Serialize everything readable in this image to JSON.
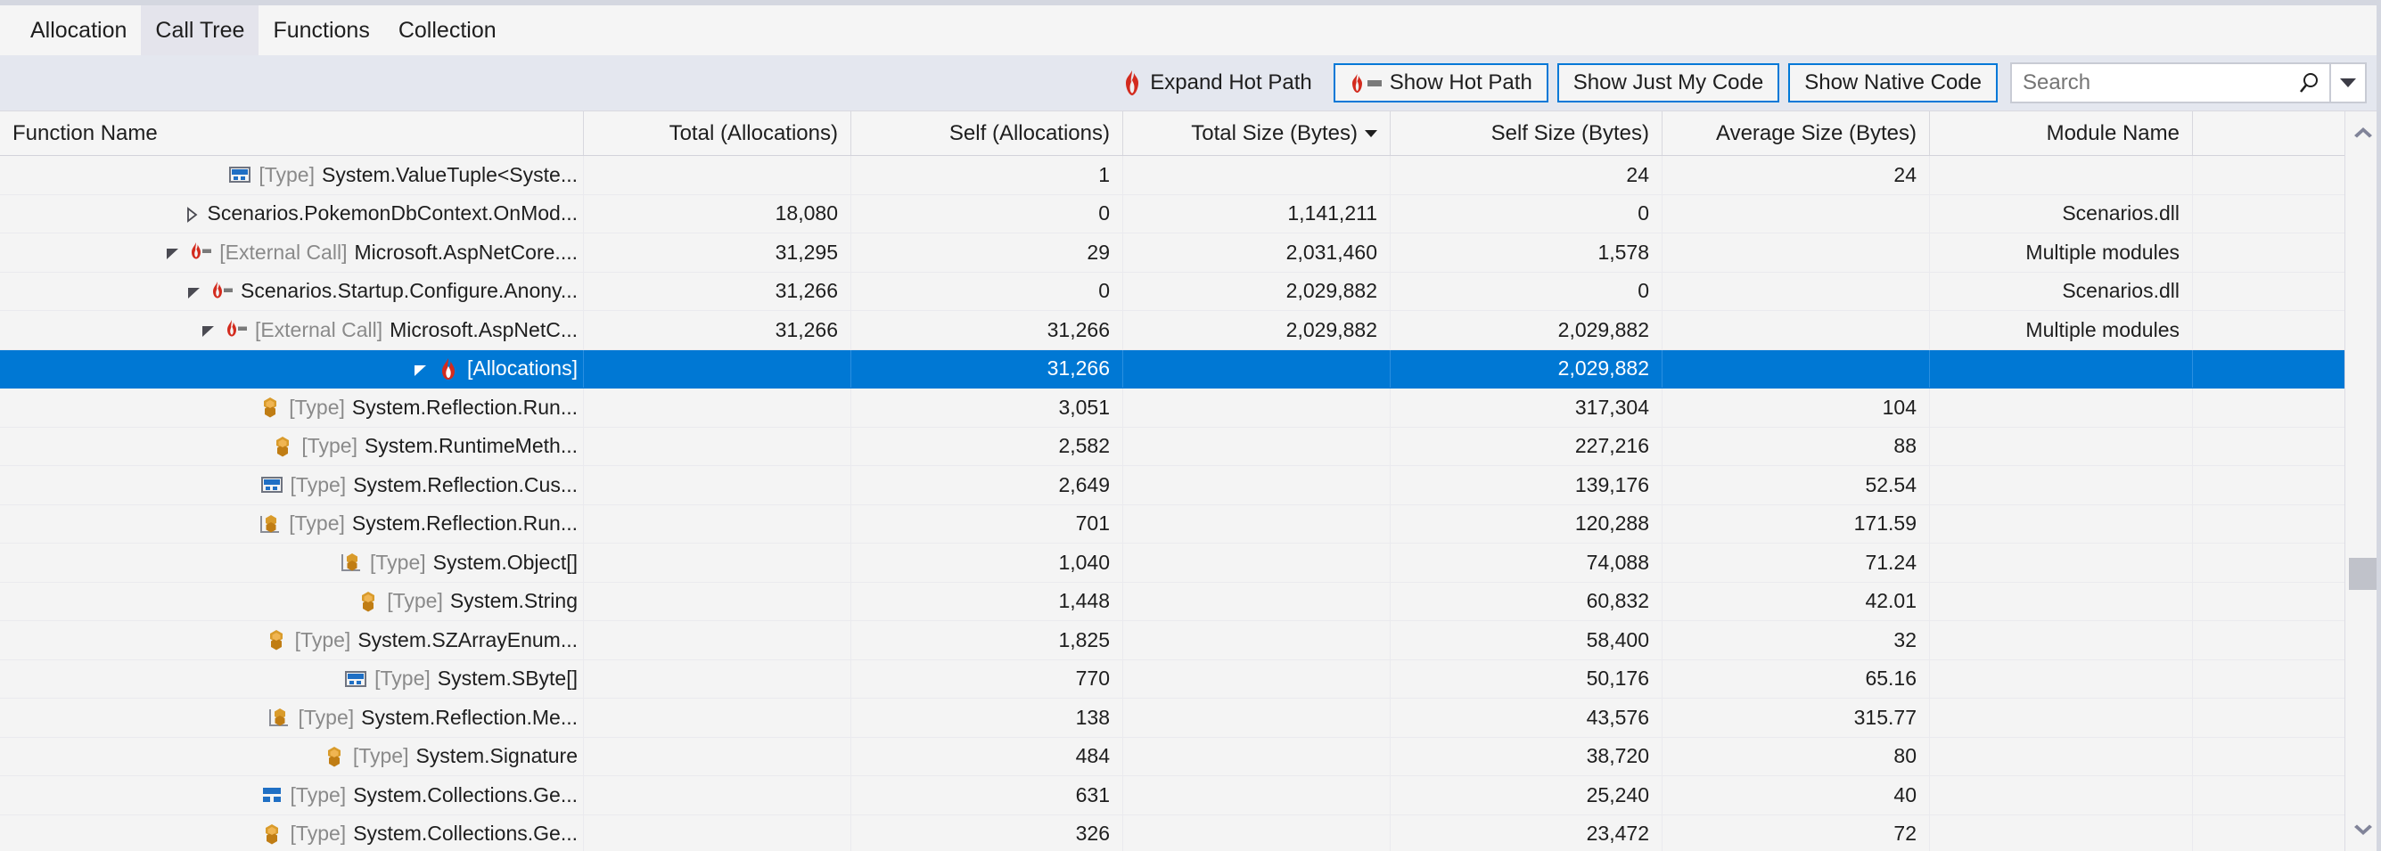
{
  "tabs": [
    {
      "label": "Allocation",
      "selected": false
    },
    {
      "label": "Call Tree",
      "selected": true
    },
    {
      "label": "Functions",
      "selected": false
    },
    {
      "label": "Collection",
      "selected": false
    }
  ],
  "toolbar": {
    "expand_hot_path": "Expand Hot Path",
    "show_hot_path": "Show Hot Path",
    "show_just_my_code": "Show Just My Code",
    "show_native_code": "Show Native Code",
    "search_placeholder": "Search",
    "search_value": "",
    "accent_color": "#0078d7",
    "flame_color": "#d32b1e"
  },
  "grid": {
    "columns": [
      {
        "label": "Function Name",
        "align": "left",
        "sorted": false
      },
      {
        "label": "Total (Allocations)",
        "align": "right",
        "sorted": false
      },
      {
        "label": "Self (Allocations)",
        "align": "right",
        "sorted": false
      },
      {
        "label": "Total Size (Bytes)",
        "align": "right",
        "sorted": true,
        "sort_dir": "desc"
      },
      {
        "label": "Self Size (Bytes)",
        "align": "right",
        "sorted": false
      },
      {
        "label": "Average Size (Bytes)",
        "align": "right",
        "sorted": false
      },
      {
        "label": "Module Name",
        "align": "right",
        "sorted": false
      }
    ],
    "selection_color": "#0078d4",
    "rows": [
      {
        "indent": 6,
        "expander": "none",
        "icon": "type-struct-icon",
        "hot": false,
        "prefix": "[Type]",
        "name": "System.ValueTuple<Syste...",
        "total_allocations": "",
        "self_allocations": "1",
        "total_size": "",
        "self_size": "24",
        "average_size": "24",
        "module": "",
        "selected": false
      },
      {
        "indent": 4,
        "expander": "collapsed",
        "icon": "none",
        "hot": false,
        "prefix": "",
        "name": "Scenarios.PokemonDbContext.OnMod...",
        "total_allocations": "18,080",
        "self_allocations": "0",
        "total_size": "1,141,211",
        "self_size": "0",
        "average_size": "",
        "module": "Scenarios.dll",
        "selected": false
      },
      {
        "indent": 4,
        "expander": "expanded",
        "icon": "hot-path-icon",
        "hot": true,
        "prefix": "[External Call]",
        "name": "Microsoft.AspNetCore....",
        "total_allocations": "31,295",
        "self_allocations": "29",
        "total_size": "2,031,460",
        "self_size": "1,578",
        "average_size": "",
        "module": "Multiple modules",
        "selected": false
      },
      {
        "indent": 5,
        "expander": "expanded",
        "icon": "hot-path-icon",
        "hot": true,
        "prefix": "",
        "name": "Scenarios.Startup.Configure.Anony...",
        "total_allocations": "31,266",
        "self_allocations": "0",
        "total_size": "2,029,882",
        "self_size": "0",
        "average_size": "",
        "module": "Scenarios.dll",
        "selected": false
      },
      {
        "indent": 6,
        "expander": "expanded",
        "icon": "hot-path-icon",
        "hot": true,
        "prefix": "[External Call]",
        "name": "Microsoft.AspNetC...",
        "total_allocations": "31,266",
        "self_allocations": "31,266",
        "total_size": "2,029,882",
        "self_size": "2,029,882",
        "average_size": "",
        "module": "Multiple modules",
        "selected": false
      },
      {
        "indent": 7,
        "expander": "expanded",
        "icon": "flame-icon",
        "hot": true,
        "prefix": "",
        "name": "[Allocations]",
        "total_allocations": "",
        "self_allocations": "31,266",
        "total_size": "",
        "self_size": "2,029,882",
        "average_size": "",
        "module": "",
        "selected": true
      },
      {
        "indent": 8,
        "expander": "none",
        "icon": "type-class-icon",
        "hot": false,
        "prefix": "[Type]",
        "name": "System.Reflection.Run...",
        "total_allocations": "",
        "self_allocations": "3,051",
        "total_size": "",
        "self_size": "317,304",
        "average_size": "104",
        "module": "",
        "selected": false
      },
      {
        "indent": 8,
        "expander": "none",
        "icon": "type-class-icon",
        "hot": false,
        "prefix": "[Type]",
        "name": "System.RuntimeMeth...",
        "total_allocations": "",
        "self_allocations": "2,582",
        "total_size": "",
        "self_size": "227,216",
        "average_size": "88",
        "module": "",
        "selected": false
      },
      {
        "indent": 8,
        "expander": "none",
        "icon": "type-struct-icon",
        "hot": false,
        "prefix": "[Type]",
        "name": "System.Reflection.Cus...",
        "total_allocations": "",
        "self_allocations": "2,649",
        "total_size": "",
        "self_size": "139,176",
        "average_size": "52.54",
        "module": "",
        "selected": false
      },
      {
        "indent": 8,
        "expander": "none",
        "icon": "type-internal-class-icon",
        "hot": false,
        "prefix": "[Type]",
        "name": "System.Reflection.Run...",
        "total_allocations": "",
        "self_allocations": "701",
        "total_size": "",
        "self_size": "120,288",
        "average_size": "171.59",
        "module": "",
        "selected": false
      },
      {
        "indent": 8,
        "expander": "none",
        "icon": "type-internal-class-icon",
        "hot": false,
        "prefix": "[Type]",
        "name": "System.Object[]",
        "total_allocations": "",
        "self_allocations": "1,040",
        "total_size": "",
        "self_size": "74,088",
        "average_size": "71.24",
        "module": "",
        "selected": false
      },
      {
        "indent": 8,
        "expander": "none",
        "icon": "type-class-icon",
        "hot": false,
        "prefix": "[Type]",
        "name": "System.String",
        "total_allocations": "",
        "self_allocations": "1,448",
        "total_size": "",
        "self_size": "60,832",
        "average_size": "42.01",
        "module": "",
        "selected": false
      },
      {
        "indent": 8,
        "expander": "none",
        "icon": "type-class-icon",
        "hot": false,
        "prefix": "[Type]",
        "name": "System.SZArrayEnum...",
        "total_allocations": "",
        "self_allocations": "1,825",
        "total_size": "",
        "self_size": "58,400",
        "average_size": "32",
        "module": "",
        "selected": false
      },
      {
        "indent": 8,
        "expander": "none",
        "icon": "type-struct-icon",
        "hot": false,
        "prefix": "[Type]",
        "name": "System.SByte[]",
        "total_allocations": "",
        "self_allocations": "770",
        "total_size": "",
        "self_size": "50,176",
        "average_size": "65.16",
        "module": "",
        "selected": false
      },
      {
        "indent": 8,
        "expander": "none",
        "icon": "type-internal-class-icon",
        "hot": false,
        "prefix": "[Type]",
        "name": "System.Reflection.Me...",
        "total_allocations": "",
        "self_allocations": "138",
        "total_size": "",
        "self_size": "43,576",
        "average_size": "315.77",
        "module": "",
        "selected": false
      },
      {
        "indent": 8,
        "expander": "none",
        "icon": "type-class-icon",
        "hot": false,
        "prefix": "[Type]",
        "name": "System.Signature",
        "total_allocations": "",
        "self_allocations": "484",
        "total_size": "",
        "self_size": "38,720",
        "average_size": "80",
        "module": "",
        "selected": false
      },
      {
        "indent": 8,
        "expander": "none",
        "icon": "type-interface-icon",
        "hot": false,
        "prefix": "[Type]",
        "name": "System.Collections.Ge...",
        "total_allocations": "",
        "self_allocations": "631",
        "total_size": "",
        "self_size": "25,240",
        "average_size": "40",
        "module": "",
        "selected": false
      },
      {
        "indent": 8,
        "expander": "none",
        "icon": "type-class-icon",
        "hot": false,
        "prefix": "[Type]",
        "name": "System.Collections.Ge...",
        "total_allocations": "",
        "self_allocations": "326",
        "total_size": "",
        "self_size": "23,472",
        "average_size": "72",
        "module": "",
        "selected": false
      }
    ]
  },
  "scrollbar": {
    "up_arrow": "scroll-up-icon",
    "down_arrow": "scroll-down-icon"
  }
}
